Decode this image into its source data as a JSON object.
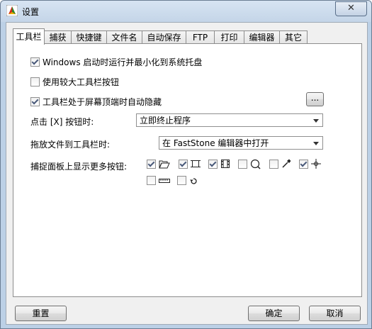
{
  "window": {
    "title": "设置",
    "close_label": "✕"
  },
  "tabs": [
    {
      "label": "工具栏",
      "active": true
    },
    {
      "label": "捕获"
    },
    {
      "label": "快捷键"
    },
    {
      "label": "文件名"
    },
    {
      "label": "自动保存"
    },
    {
      "label": "FTP"
    },
    {
      "label": "打印"
    },
    {
      "label": "编辑器"
    },
    {
      "label": "其它"
    }
  ],
  "options": {
    "minimize_to_tray": {
      "label": "Windows 启动时运行并最小化到系统托盘",
      "checked": true
    },
    "large_buttons": {
      "label": "使用较大工具栏按钮",
      "checked": false
    },
    "auto_hide": {
      "label": "工具栏处于屏幕顶端时自动隐藏",
      "checked": true
    },
    "more_button_label": "..."
  },
  "close_click": {
    "label": "点击 [X] 按钮时:",
    "value": "立即终止程序"
  },
  "drag_drop": {
    "label": "拖放文件到工具栏时:",
    "value": "在 FastStone 编辑器中打开"
  },
  "capture_panel": {
    "label": "捕捉面板上显示更多按钮:",
    "buttons": [
      {
        "icon": "open-folder-icon",
        "checked": true
      },
      {
        "icon": "rectangle-capture-icon",
        "checked": true
      },
      {
        "icon": "film-record-icon",
        "checked": true
      },
      {
        "icon": "magnifier-icon",
        "checked": false
      },
      {
        "icon": "color-picker-icon",
        "checked": false
      },
      {
        "icon": "crosshair-icon",
        "checked": true
      },
      {
        "icon": "ruler-icon",
        "checked": false
      },
      {
        "icon": "rotate-icon",
        "checked": false
      }
    ]
  },
  "footer": {
    "reset": "重置",
    "ok": "确定",
    "cancel": "取消"
  }
}
